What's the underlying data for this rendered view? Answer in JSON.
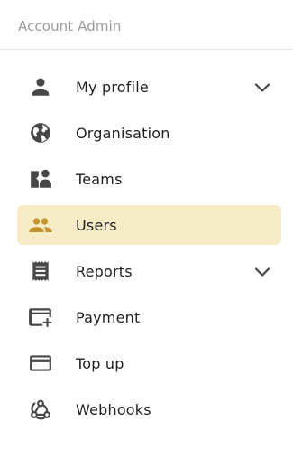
{
  "header": {
    "title": "Account Admin"
  },
  "colors": {
    "icon": "#474747",
    "active_icon": "#c4922a",
    "active_bg": "#f5ebc5",
    "title": "#9a9a9a"
  },
  "nav": {
    "items": [
      {
        "label": "My profile",
        "icon": "person-icon",
        "expandable": true,
        "active": false
      },
      {
        "label": "Organisation",
        "icon": "globe-icon",
        "expandable": false,
        "active": false
      },
      {
        "label": "Teams",
        "icon": "teams-icon",
        "expandable": false,
        "active": false
      },
      {
        "label": "Users",
        "icon": "people-icon",
        "expandable": false,
        "active": true
      },
      {
        "label": "Reports",
        "icon": "receipt-icon",
        "expandable": true,
        "active": false
      },
      {
        "label": "Payment",
        "icon": "add-card-icon",
        "expandable": false,
        "active": false
      },
      {
        "label": "Top up",
        "icon": "credit-card-icon",
        "expandable": false,
        "active": false
      },
      {
        "label": "Webhooks",
        "icon": "webhook-icon",
        "expandable": false,
        "active": false
      }
    ]
  }
}
